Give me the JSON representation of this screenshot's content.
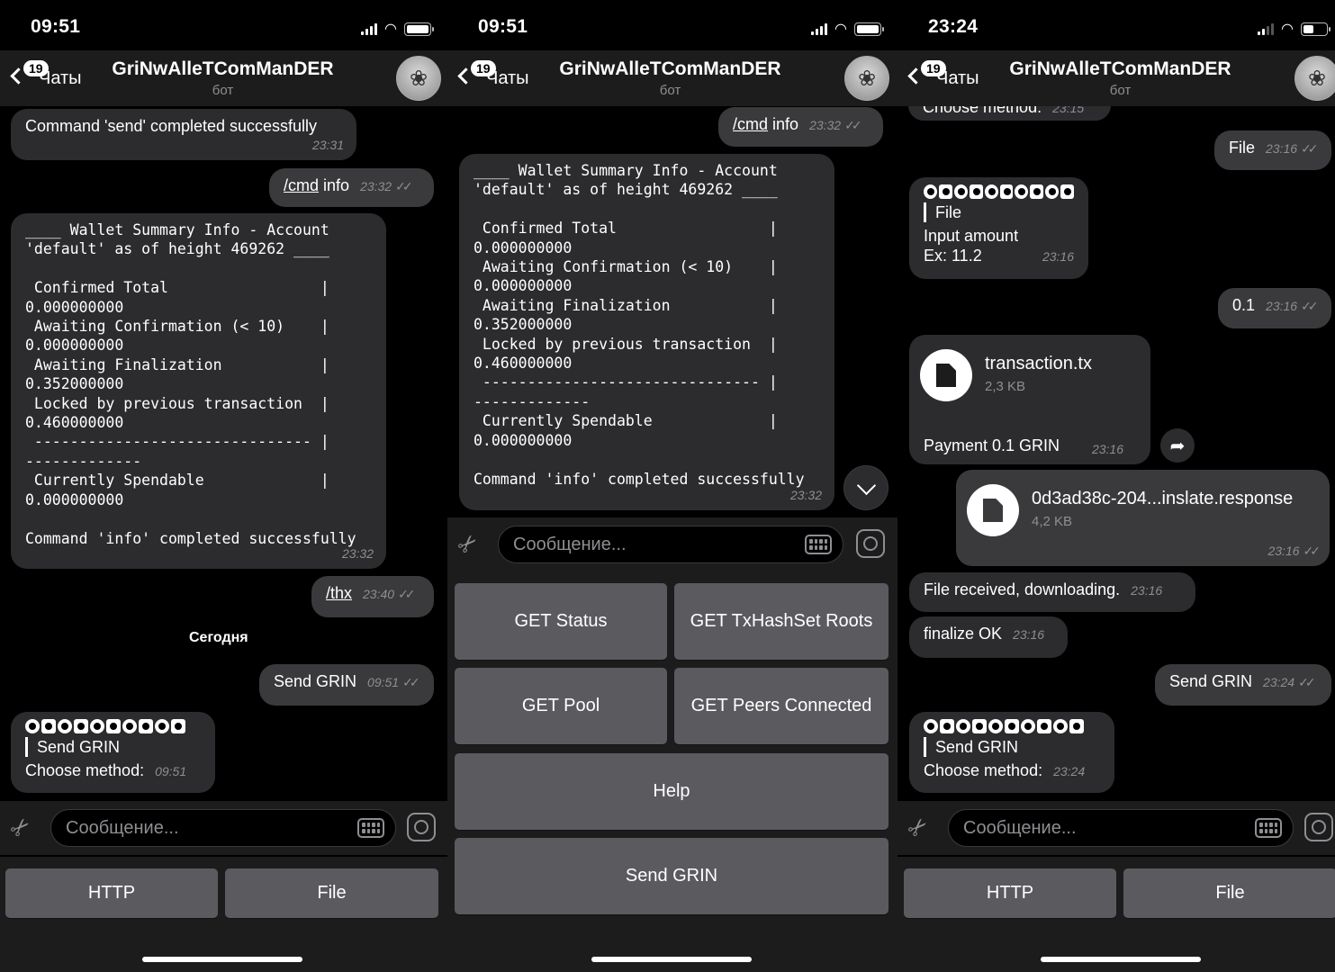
{
  "screens": [
    {
      "time": "09:51",
      "back_badge": "19",
      "back_label": "Чаты",
      "title": "GriNwAlleTComManDER",
      "subtitle": "бот",
      "messages": {
        "send_completed": {
          "text": "Command 'send' completed successfully",
          "time": "23:31"
        },
        "cmd_info": {
          "cmd": "/cmd",
          "arg": "info",
          "time": "23:32"
        },
        "summary": {
          "text": "____ Wallet Summary Info - Account\n'default' as of height 469262 ____\n\n Confirmed Total                 |\n0.000000000\n Awaiting Confirmation (< 10)    |\n0.000000000\n Awaiting Finalization           |\n0.352000000\n Locked by previous transaction  |\n0.460000000\n ------------------------------- |\n-------------\n Currently Spendable             |\n0.000000000\n\nCommand 'info' completed successfully",
          "time": "23:32"
        },
        "thx": {
          "text": "/thx",
          "time": "23:40"
        },
        "date_separator": "Сегодня",
        "send_grin_out": {
          "text": "Send GRIN",
          "time": "09:51"
        },
        "choose": {
          "caption": "Send GRIN",
          "text": "Choose method:",
          "time": "09:51"
        }
      },
      "input_placeholder": "Сообщение...",
      "keyboard": [
        "HTTP",
        "File"
      ]
    },
    {
      "time": "09:51",
      "back_badge": "19",
      "back_label": "Чаты",
      "title": "GriNwAlleTComManDER",
      "subtitle": "бот",
      "messages": {
        "cmd_info": {
          "cmd": "/cmd",
          "arg": "info",
          "time": "23:32"
        },
        "summary": {
          "text": "____ Wallet Summary Info - Account\n'default' as of height 469262 ____\n\n Confirmed Total                 |\n0.000000000\n Awaiting Confirmation (< 10)    |\n0.000000000\n Awaiting Finalization           |\n0.352000000\n Locked by previous transaction  |\n0.460000000\n ------------------------------- |\n-------------\n Currently Spendable             |\n0.000000000\n\nCommand 'info' completed successfully",
          "time": "23:32"
        }
      },
      "input_placeholder": "Сообщение...",
      "keyboard": [
        "GET Status",
        "GET TxHashSet Roots",
        "GET Pool",
        "GET Peers Connected",
        "Help",
        "Send GRIN"
      ]
    },
    {
      "time": "23:24",
      "back_badge": "19",
      "back_label": "Чаты",
      "title": "GriNwAlleTComManDER",
      "subtitle": "бот",
      "messages": {
        "choose_cut": {
          "text": "Choose method:",
          "time": "23:15"
        },
        "file_out": {
          "text": "File",
          "time": "23:16"
        },
        "input_amount": {
          "caption": "File",
          "text1": "Input amount",
          "text2": "Ex: 11.2",
          "time": "23:16"
        },
        "amount_out": {
          "text": "0.1",
          "time": "23:16"
        },
        "tx_file": {
          "name": "transaction.tx",
          "size": "2,3 KB",
          "caption": "Payment 0.1 GRIN",
          "time": "23:16"
        },
        "response_file": {
          "name": "0d3ad38c-204...inslate.response",
          "size": "4,2 KB",
          "time": "23:16"
        },
        "received": {
          "text": "File received, downloading.",
          "time": "23:16"
        },
        "finalize": {
          "text": "finalize OK",
          "time": "23:16"
        },
        "send_grin_out": {
          "text": "Send GRIN",
          "time": "23:24"
        },
        "choose": {
          "caption": "Send GRIN",
          "text": "Choose method:",
          "time": "23:24"
        }
      },
      "input_placeholder": "Сообщение...",
      "keyboard": [
        "HTTP",
        "File"
      ]
    }
  ]
}
